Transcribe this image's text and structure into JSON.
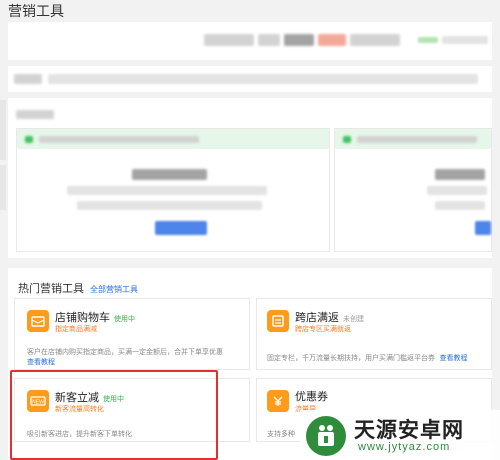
{
  "page_title": "营销工具",
  "hot_tools": {
    "title": "热门营销工具",
    "all_link": "全部营销工具",
    "cards": [
      {
        "title": "店铺购物车",
        "status": "使用中",
        "status_color": "#35b34a",
        "subtitle": "指定商品满减",
        "description": "客户在店铺内购买指定商品，买满一定金额后，合并下单享优惠",
        "tutorial": "查看教程",
        "icon": "cart-coupon-icon"
      },
      {
        "title": "跨店满返",
        "status": "未创建",
        "status_color": "#999999",
        "subtitle": "跨店专区买满就返",
        "description": "固定专栏，千万流量长期扶持，用户买满门槛返平台券",
        "tutorial": "查看教程",
        "icon": "cross-store-rebate-icon"
      },
      {
        "title": "新客立减",
        "status": "使用中",
        "status_color": "#35b34a",
        "subtitle": "新客流量高转化",
        "description": "吸引新客进店，提升新客下单转化",
        "icon": "new-customer-icon"
      },
      {
        "title": "优惠券",
        "subtitle": "流量导",
        "description": "支持多种",
        "icon": "coupon-icon"
      }
    ]
  },
  "watermark": {
    "name": "天源安卓网",
    "url": "www.jytyaz.com"
  },
  "colors": {
    "accent_orange": "#ff9b1a",
    "highlight_red": "#e23030",
    "link_blue": "#2a6fdb"
  }
}
